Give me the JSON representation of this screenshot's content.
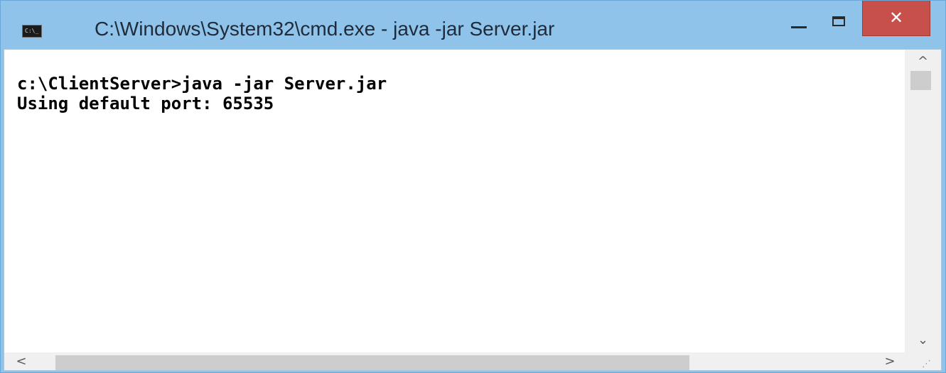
{
  "window": {
    "title": "C:\\Windows\\System32\\cmd.exe - java  -jar Server.jar",
    "app_icon_text": "C:\\_",
    "app_icon": "cmd-console-icon",
    "controls": {
      "minimize_icon": "minimize-icon",
      "maximize_icon": "maximize-icon",
      "close_icon": "close-icon",
      "close_glyph": "✕",
      "close_color": "#c7504b"
    },
    "title_bar_color": "#8fc3ea"
  },
  "console": {
    "lines": [
      "c:\\ClientServer>java -jar Server.jar",
      "Using default port: 65535"
    ],
    "text_color": "#000000",
    "background": "#ffffff"
  },
  "scrollbars": {
    "up_arrow": "^",
    "down_arrow": "⌄",
    "left_arrow": "<",
    "right_arrow": ">",
    "grip": "⋰"
  }
}
